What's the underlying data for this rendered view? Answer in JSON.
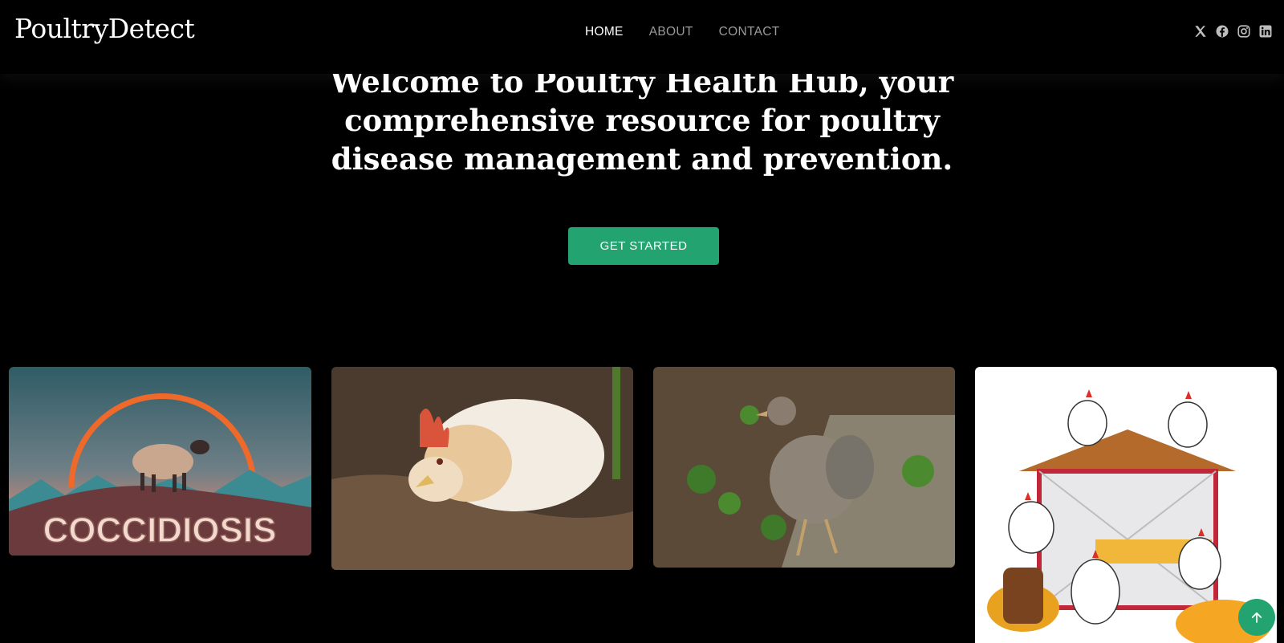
{
  "brand": {
    "logo_text": "PoultryDetect"
  },
  "nav": {
    "items": [
      {
        "label": "HOME",
        "active": true
      },
      {
        "label": "ABOUT",
        "active": false
      },
      {
        "label": "CONTACT",
        "active": false
      }
    ]
  },
  "socials": [
    "x-icon",
    "facebook-icon",
    "instagram-icon",
    "linkedin-icon"
  ],
  "hero": {
    "title": "Welcome to Poultry Health Hub, your comprehensive resource for poultry disease management and prevention.",
    "cta_label": "GET STARTED"
  },
  "gallery": {
    "cards": [
      {
        "name": "coccidiosis-image",
        "caption_text": "COCCIDIOSIS"
      },
      {
        "name": "resting-hen-image"
      },
      {
        "name": "pullet-image"
      },
      {
        "name": "chicken-coop-cartoon-image"
      }
    ]
  },
  "colors": {
    "accent": "#22a36f",
    "background": "#000000",
    "nav_inactive": "#9a9a9a"
  }
}
